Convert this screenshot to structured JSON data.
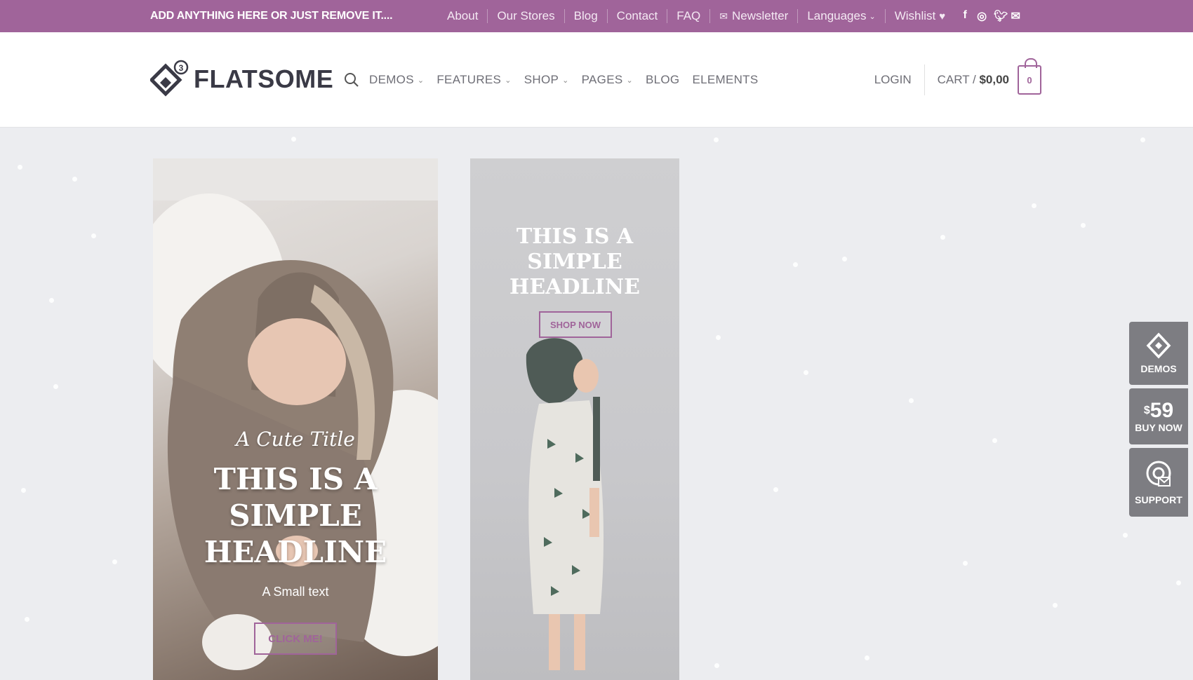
{
  "topbar": {
    "promo": "ADD ANYTHING HERE OR JUST REMOVE IT....",
    "links": [
      "About",
      "Our Stores",
      "Blog",
      "Contact",
      "FAQ"
    ],
    "newsletter": "Newsletter",
    "languages": "Languages",
    "wishlist": "Wishlist",
    "socials": [
      "facebook-icon",
      "instagram-icon",
      "twitter-icon",
      "email-icon"
    ],
    "bg_color": "#a0649a"
  },
  "header": {
    "logo_text": "FLATSOME",
    "logo_badge": "3",
    "nav": [
      {
        "label": "DEMOS",
        "dropdown": true
      },
      {
        "label": "FEATURES",
        "dropdown": true
      },
      {
        "label": "SHOP",
        "dropdown": true
      },
      {
        "label": "PAGES",
        "dropdown": true
      },
      {
        "label": "BLOG",
        "dropdown": false
      },
      {
        "label": "ELEMENTS",
        "dropdown": false
      }
    ],
    "login": "LOGIN",
    "cart_label": "CART /",
    "cart_amount": "$0,00",
    "cart_count": "0"
  },
  "banner1": {
    "cute_title": "A Cute Title",
    "headline_lines": [
      "THIS IS A",
      "SIMPLE",
      "HEADLINE"
    ],
    "small_text": "A Small text",
    "button": "CLICK ME!"
  },
  "banner2": {
    "headline_lines": [
      "THIS IS A",
      "SIMPLE",
      "HEADLINE"
    ],
    "button": "SHOP NOW"
  },
  "side_widgets": {
    "demos": "DEMOS",
    "price": "59",
    "currency": "$",
    "buy_now": "BUY NOW",
    "support": "SUPPORT"
  }
}
